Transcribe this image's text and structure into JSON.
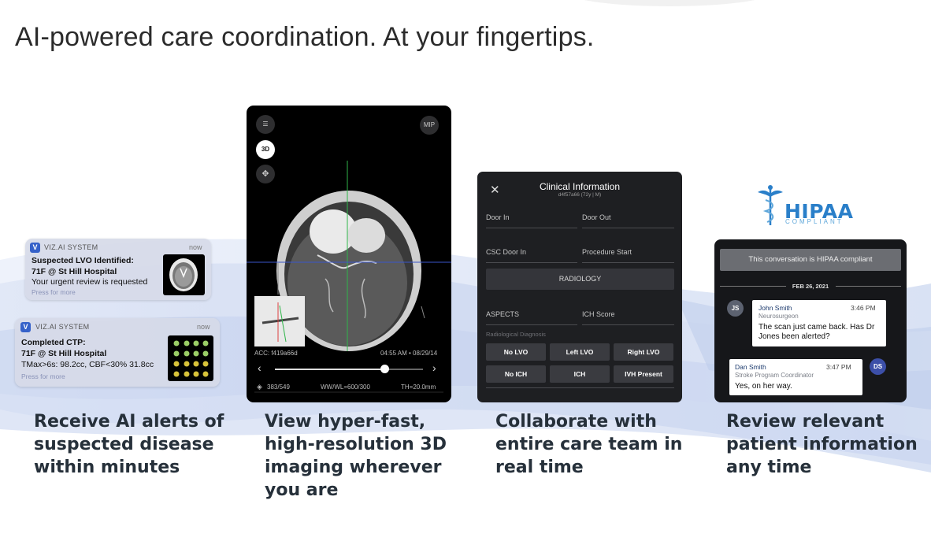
{
  "headline": "AI-powered care coordination. At your fingertips.",
  "colors": {
    "accent_blue": "#2a7fc9",
    "panel_dark": "#1e1f22",
    "caption": "#26303a"
  },
  "notifications": [
    {
      "app": "VIZ.AI SYSTEM",
      "time": "now",
      "lines": [
        "Suspected LVO Identified:",
        "71F @ St Hill Hospital",
        "Your urgent review is requested"
      ],
      "press": "Press for more",
      "thumb_icon": "brain-scan-icon"
    },
    {
      "app": "VIZ.AI SYSTEM",
      "time": "now",
      "lines": [
        "Completed CTP:",
        "71F @ St Hill Hospital",
        "TMax>6s: 98.2cc, CBF<30% 31.8cc"
      ],
      "press": "Press for more",
      "thumb_icon": "perfusion-grid-icon"
    }
  ],
  "viewer": {
    "mip_label": "MIP",
    "btn_3d": "3D",
    "acc": "ACC: f419a66d",
    "timestamp": "04:55 AM • 08/29/14",
    "slice": "383/549",
    "wwwl": "WW/WL=600/300",
    "th": "TH=20.0mm",
    "slider_progress": 0.74,
    "prev_glyph": "‹",
    "next_glyph": "›"
  },
  "clinical": {
    "title": "Clinical Information",
    "subtitle": "d4f57a66 (72y | M)",
    "close_glyph": "✕",
    "door_in": "Door In",
    "door_out": "Door Out",
    "csc_door_in": "CSC Door In",
    "procedure_start": "Procedure Start",
    "radiology": "RADIOLOGY",
    "aspects": "ASPECTS",
    "ich_score": "ICH Score",
    "radiological_diagnosis": "Radiological Diagnosis",
    "chips": [
      "No LVO",
      "Left LVO",
      "Right LVO",
      "No ICH",
      "ICH",
      "IVH Present"
    ]
  },
  "hipaa": {
    "logo_word": "HIPAA",
    "logo_sub": "COMPLIANT",
    "banner": "This conversation is HIPAA compliant",
    "date": "FEB 26, 2021",
    "messages": [
      {
        "initials": "JS",
        "name": "John Smith",
        "role": "Neurosurgeon",
        "time": "3:46 PM",
        "text_l1": "The scan just came back. Has Dr",
        "text_l2": "Jones been alerted?"
      },
      {
        "initials": "DS",
        "name": "Dan Smith",
        "role": "Stroke Program Coordinator",
        "time": "3:47 PM",
        "text_l1": "Yes, on her way."
      }
    ]
  },
  "captions": [
    [
      "Receive AI alerts of",
      "suspected disease",
      "within minutes"
    ],
    [
      "View hyper-fast,",
      "high-resolution 3D",
      "imaging wherever",
      "you are"
    ],
    [
      "Collaborate with",
      "entire care team in",
      "real time"
    ],
    [
      "Review relevant",
      "patient information",
      "any time"
    ]
  ]
}
